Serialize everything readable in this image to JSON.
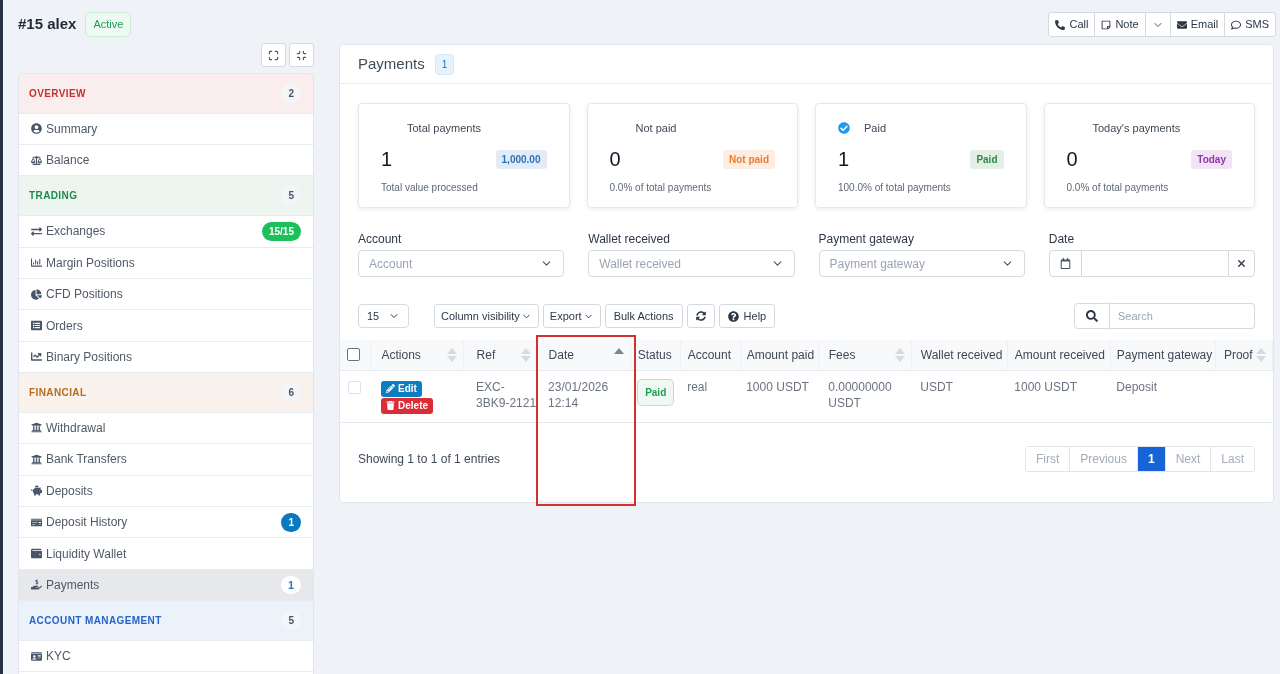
{
  "customer": {
    "title": "#15 alex",
    "status": "Active"
  },
  "contact_actions": [
    {
      "kind": "button",
      "label": "Call"
    },
    {
      "kind": "button",
      "label": "Note"
    },
    {
      "kind": "menu"
    },
    {
      "kind": "button",
      "label": "Email"
    },
    {
      "kind": "button",
      "label": "SMS"
    }
  ],
  "sidebar": {
    "sections": [
      {
        "title": "OVERVIEW",
        "count": "2",
        "color": "#c53030",
        "items": [
          {
            "label": "Summary",
            "selected": false
          },
          {
            "label": "Balance",
            "selected": false
          }
        ]
      },
      {
        "title": "TRADING",
        "count": "5",
        "color": "#1f8a4c",
        "items": [
          {
            "label": "Exchanges",
            "selected": false,
            "badge": {
              "text": "15/15",
              "kind": "solid",
              "color": "#1dbf5c"
            }
          },
          {
            "label": "Margin Positions",
            "selected": false
          },
          {
            "label": "CFD Positions",
            "selected": false
          },
          {
            "label": "Orders",
            "selected": false
          },
          {
            "label": "Binary Positions",
            "selected": false
          }
        ]
      },
      {
        "title": "FINANCIAL",
        "count": "6",
        "color": "#b66d22",
        "items": [
          {
            "label": "Withdrawal",
            "selected": false
          },
          {
            "label": "Bank Transfers",
            "selected": false
          },
          {
            "label": "Deposits",
            "selected": false
          },
          {
            "label": "Deposit History",
            "selected": false,
            "badge": {
              "text": "1",
              "kind": "solid",
              "color": "#0b79c2"
            }
          },
          {
            "label": "Liquidity Wallet",
            "selected": false
          },
          {
            "label": "Payments",
            "selected": true,
            "badge": {
              "text": "1",
              "kind": "light",
              "color": "#2a79bd"
            }
          }
        ]
      },
      {
        "title": "ACCOUNT MANAGEMENT",
        "count": "5",
        "color": "#2563c9",
        "items": [
          {
            "label": "KYC",
            "selected": false
          }
        ]
      }
    ]
  },
  "payments_panel": {
    "title": "Payments",
    "count": "1",
    "stats": [
      {
        "title": "Total payments",
        "value": "1",
        "tag": {
          "text": "1,000.00",
          "color": "#2b73b8"
        },
        "note": "Total value processed",
        "check_icon": false
      },
      {
        "title": "Not paid",
        "value": "0",
        "tag": {
          "text": "Not paid",
          "color": "#f07b2a"
        },
        "note": "0.0% of total payments",
        "check_icon": false
      },
      {
        "title": "Paid",
        "value": "1",
        "tag": {
          "text": "Paid",
          "color": "#2f8a46"
        },
        "note": "100.0% of total payments",
        "check_icon": true
      },
      {
        "title": "Today's payments",
        "value": "0",
        "tag": {
          "text": "Today",
          "color": "#9333ae"
        },
        "note": "0.0% of total payments",
        "check_icon": false
      }
    ],
    "filters": [
      {
        "kind": "select",
        "label": "Account",
        "placeholder": "Account"
      },
      {
        "kind": "select",
        "label": "Wallet received",
        "placeholder": "Wallet received"
      },
      {
        "kind": "select",
        "label": "Payment gateway",
        "placeholder": "Payment gateway"
      },
      {
        "kind": "date",
        "label": "Date"
      }
    ],
    "page_size": "15",
    "tools": [
      {
        "kind": "dropdown",
        "label": "Column visibility"
      },
      {
        "kind": "dropdown",
        "label": "Export"
      },
      {
        "kind": "plain",
        "label": "Bulk Actions"
      },
      {
        "kind": "refresh"
      },
      {
        "kind": "help",
        "label": "Help"
      }
    ],
    "search": {
      "placeholder": "Search"
    },
    "table": {
      "select_all": {
        "checked": false
      },
      "columns": [
        {
          "label": "Actions",
          "sortable": true,
          "ascending": false,
          "highlighted": false
        },
        {
          "label": "Ref",
          "sortable": true,
          "ascending": false,
          "highlighted": false
        },
        {
          "label": "Date",
          "sortable": true,
          "ascending": true,
          "highlighted": true
        },
        {
          "label": "Status",
          "sortable": false,
          "highlighted": false
        },
        {
          "label": "Account",
          "sortable": false,
          "highlighted": false
        },
        {
          "label": "Amount paid",
          "sortable": false,
          "highlighted": false
        },
        {
          "label": "Fees",
          "sortable": true,
          "ascending": false,
          "highlighted": false
        },
        {
          "label": "Wallet received",
          "sortable": false,
          "highlighted": false
        },
        {
          "label": "Amount received",
          "sortable": false,
          "highlighted": false
        },
        {
          "label": "Payment gateway",
          "sortable": false,
          "highlighted": false
        },
        {
          "label": "Proof",
          "sortable": true,
          "ascending": false,
          "highlighted": false
        }
      ],
      "rows": [
        {
          "checked": false,
          "cells": [
            {
              "kind": "actions",
              "buttons": [
                {
                  "kind": "edit",
                  "label": "Edit"
                },
                {
                  "kind": "delete",
                  "label": "Delete"
                }
              ]
            },
            {
              "kind": "text",
              "text": "EXC-3BK9-2121"
            },
            {
              "kind": "text",
              "text": "23/01/2026 12:14"
            },
            {
              "kind": "status",
              "text": "Paid",
              "color": "#1f9d55"
            },
            {
              "kind": "text",
              "text": "real"
            },
            {
              "kind": "text",
              "text": "1000 USDT"
            },
            {
              "kind": "text",
              "text": "0.00000000 USDT"
            },
            {
              "kind": "text",
              "text": "USDT"
            },
            {
              "kind": "text",
              "text": "1000 USDT"
            },
            {
              "kind": "text",
              "text": "Deposit"
            }
          ]
        }
      ]
    },
    "info": "Showing 1 to 1 of 1 entries",
    "pagination": [
      {
        "label": "First",
        "selected": false,
        "disabled": true
      },
      {
        "label": "Previous",
        "selected": false,
        "disabled": true
      },
      {
        "label": "1",
        "selected": true,
        "disabled": false
      },
      {
        "label": "Next",
        "selected": false,
        "disabled": true
      },
      {
        "label": "Last",
        "selected": false,
        "disabled": true
      }
    ]
  }
}
